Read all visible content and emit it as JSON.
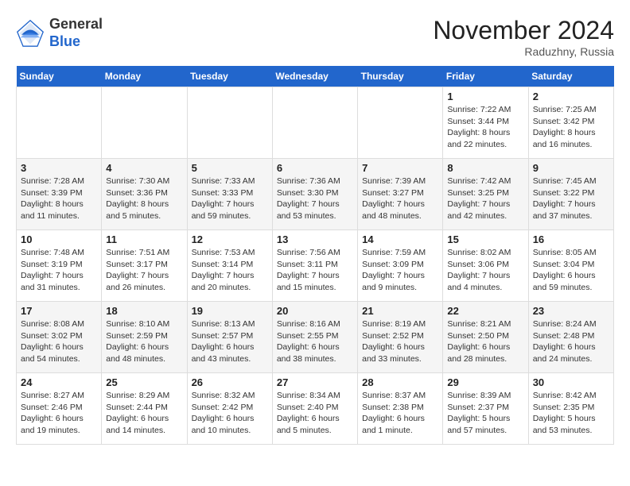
{
  "header": {
    "logo_general": "General",
    "logo_blue": "Blue",
    "month_title": "November 2024",
    "subtitle": "Raduzhny, Russia"
  },
  "weekdays": [
    "Sunday",
    "Monday",
    "Tuesday",
    "Wednesday",
    "Thursday",
    "Friday",
    "Saturday"
  ],
  "weeks": [
    [
      {
        "day": "",
        "info": ""
      },
      {
        "day": "",
        "info": ""
      },
      {
        "day": "",
        "info": ""
      },
      {
        "day": "",
        "info": ""
      },
      {
        "day": "",
        "info": ""
      },
      {
        "day": "1",
        "info": "Sunrise: 7:22 AM\nSunset: 3:44 PM\nDaylight: 8 hours\nand 22 minutes."
      },
      {
        "day": "2",
        "info": "Sunrise: 7:25 AM\nSunset: 3:42 PM\nDaylight: 8 hours\nand 16 minutes."
      }
    ],
    [
      {
        "day": "3",
        "info": "Sunrise: 7:28 AM\nSunset: 3:39 PM\nDaylight: 8 hours\nand 11 minutes."
      },
      {
        "day": "4",
        "info": "Sunrise: 7:30 AM\nSunset: 3:36 PM\nDaylight: 8 hours\nand 5 minutes."
      },
      {
        "day": "5",
        "info": "Sunrise: 7:33 AM\nSunset: 3:33 PM\nDaylight: 7 hours\nand 59 minutes."
      },
      {
        "day": "6",
        "info": "Sunrise: 7:36 AM\nSunset: 3:30 PM\nDaylight: 7 hours\nand 53 minutes."
      },
      {
        "day": "7",
        "info": "Sunrise: 7:39 AM\nSunset: 3:27 PM\nDaylight: 7 hours\nand 48 minutes."
      },
      {
        "day": "8",
        "info": "Sunrise: 7:42 AM\nSunset: 3:25 PM\nDaylight: 7 hours\nand 42 minutes."
      },
      {
        "day": "9",
        "info": "Sunrise: 7:45 AM\nSunset: 3:22 PM\nDaylight: 7 hours\nand 37 minutes."
      }
    ],
    [
      {
        "day": "10",
        "info": "Sunrise: 7:48 AM\nSunset: 3:19 PM\nDaylight: 7 hours\nand 31 minutes."
      },
      {
        "day": "11",
        "info": "Sunrise: 7:51 AM\nSunset: 3:17 PM\nDaylight: 7 hours\nand 26 minutes."
      },
      {
        "day": "12",
        "info": "Sunrise: 7:53 AM\nSunset: 3:14 PM\nDaylight: 7 hours\nand 20 minutes."
      },
      {
        "day": "13",
        "info": "Sunrise: 7:56 AM\nSunset: 3:11 PM\nDaylight: 7 hours\nand 15 minutes."
      },
      {
        "day": "14",
        "info": "Sunrise: 7:59 AM\nSunset: 3:09 PM\nDaylight: 7 hours\nand 9 minutes."
      },
      {
        "day": "15",
        "info": "Sunrise: 8:02 AM\nSunset: 3:06 PM\nDaylight: 7 hours\nand 4 minutes."
      },
      {
        "day": "16",
        "info": "Sunrise: 8:05 AM\nSunset: 3:04 PM\nDaylight: 6 hours\nand 59 minutes."
      }
    ],
    [
      {
        "day": "17",
        "info": "Sunrise: 8:08 AM\nSunset: 3:02 PM\nDaylight: 6 hours\nand 54 minutes."
      },
      {
        "day": "18",
        "info": "Sunrise: 8:10 AM\nSunset: 2:59 PM\nDaylight: 6 hours\nand 48 minutes."
      },
      {
        "day": "19",
        "info": "Sunrise: 8:13 AM\nSunset: 2:57 PM\nDaylight: 6 hours\nand 43 minutes."
      },
      {
        "day": "20",
        "info": "Sunrise: 8:16 AM\nSunset: 2:55 PM\nDaylight: 6 hours\nand 38 minutes."
      },
      {
        "day": "21",
        "info": "Sunrise: 8:19 AM\nSunset: 2:52 PM\nDaylight: 6 hours\nand 33 minutes."
      },
      {
        "day": "22",
        "info": "Sunrise: 8:21 AM\nSunset: 2:50 PM\nDaylight: 6 hours\nand 28 minutes."
      },
      {
        "day": "23",
        "info": "Sunrise: 8:24 AM\nSunset: 2:48 PM\nDaylight: 6 hours\nand 24 minutes."
      }
    ],
    [
      {
        "day": "24",
        "info": "Sunrise: 8:27 AM\nSunset: 2:46 PM\nDaylight: 6 hours\nand 19 minutes."
      },
      {
        "day": "25",
        "info": "Sunrise: 8:29 AM\nSunset: 2:44 PM\nDaylight: 6 hours\nand 14 minutes."
      },
      {
        "day": "26",
        "info": "Sunrise: 8:32 AM\nSunset: 2:42 PM\nDaylight: 6 hours\nand 10 minutes."
      },
      {
        "day": "27",
        "info": "Sunrise: 8:34 AM\nSunset: 2:40 PM\nDaylight: 6 hours\nand 5 minutes."
      },
      {
        "day": "28",
        "info": "Sunrise: 8:37 AM\nSunset: 2:38 PM\nDaylight: 6 hours\nand 1 minute."
      },
      {
        "day": "29",
        "info": "Sunrise: 8:39 AM\nSunset: 2:37 PM\nDaylight: 5 hours\nand 57 minutes."
      },
      {
        "day": "30",
        "info": "Sunrise: 8:42 AM\nSunset: 2:35 PM\nDaylight: 5 hours\nand 53 minutes."
      }
    ]
  ]
}
